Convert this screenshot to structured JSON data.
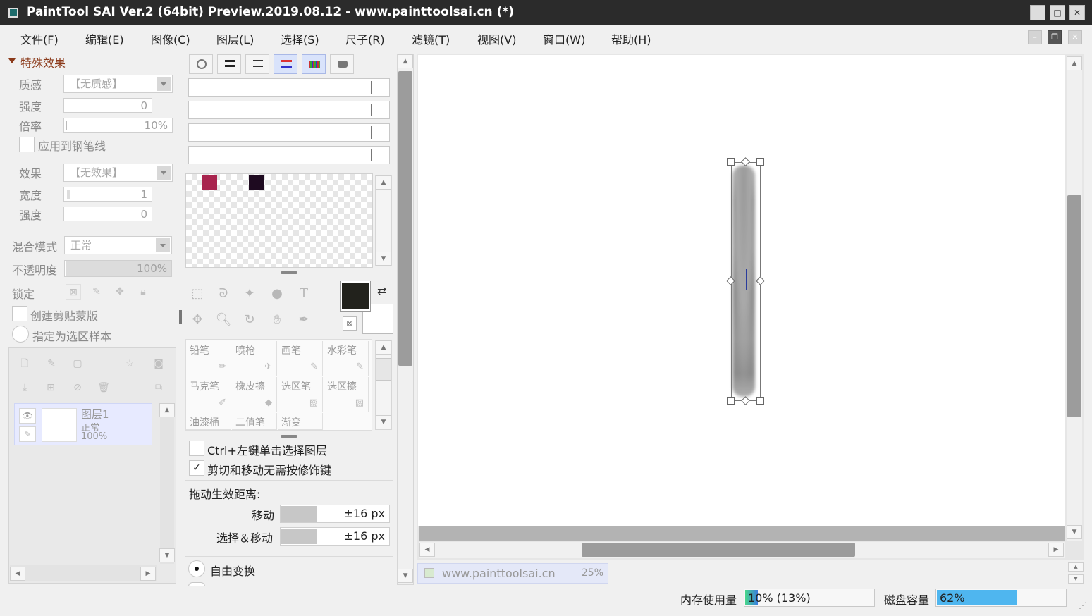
{
  "window": {
    "title": "PaintTool SAI Ver.2 (64bit) Preview.2019.08.12 - www.painttoolsai.cn (*)"
  },
  "menu": [
    "文件(F)",
    "编辑(E)",
    "图像(C)",
    "图层(L)",
    "选择(S)",
    "尺子(R)",
    "滤镜(T)",
    "视图(V)",
    "窗口(W)",
    "帮助(H)"
  ],
  "effects": {
    "header": "特殊效果",
    "texture_label": "质感",
    "texture_value": "【无质感】",
    "strength_label": "强度",
    "strength_value": "0",
    "scale_label": "倍率",
    "scale_value": "10%",
    "apply_pen_label": "应用到钢笔线",
    "effect_label": "效果",
    "effect_value": "【无效果】",
    "width_label": "宽度",
    "width_value": "1",
    "strength2_label": "强度",
    "strength2_value": "0"
  },
  "layer_props": {
    "blend_label": "混合模式",
    "blend_value": "正常",
    "opacity_label": "不透明度",
    "opacity_value": "100%",
    "opacity_level": 1.0,
    "lock_label": "锁定",
    "clip_label": "创建剪贴蒙版",
    "selection_source_label": "指定为选区样本"
  },
  "layers": [
    {
      "name": "图层1",
      "mode": "正常",
      "opacity": "100%"
    }
  ],
  "swatches": {
    "colors": [
      "#a8244e",
      "#1e0a20"
    ]
  },
  "colors": {
    "primary": "#22221c",
    "secondary": "#ffffff",
    "accent_border": "#e5a47a"
  },
  "brushes": [
    {
      "name": "铅笔",
      "icon": "pencil-icon"
    },
    {
      "name": "喷枪",
      "icon": "airbrush-icon"
    },
    {
      "name": "画笔",
      "icon": "brush-icon"
    },
    {
      "name": "水彩笔",
      "icon": "watercolor-icon"
    },
    {
      "name": "马克笔",
      "icon": "marker-icon"
    },
    {
      "name": "橡皮擦",
      "icon": "eraser-icon"
    },
    {
      "name": "选区笔",
      "icon": "select-pen-icon"
    },
    {
      "name": "选区擦",
      "icon": "select-eraser-icon"
    },
    {
      "name": "油漆桶",
      "icon": "bucket-icon"
    },
    {
      "name": "二值笔",
      "icon": "binary-pen-icon"
    },
    {
      "name": "渐变",
      "icon": "gradient-icon"
    }
  ],
  "options": {
    "ctrl_click_label": "Ctrl+左键单击选择图层",
    "ctrl_click_checked": false,
    "cut_move_label": "剪切和移动无需按修饰键",
    "cut_move_checked": true,
    "drag_distance_label": "拖动生效距离:",
    "move_label": "移动",
    "move_value": "±16 px",
    "select_move_label": "选择＆移动",
    "select_move_value": "±16 px",
    "free_transform_label": "自由变换",
    "free_transform_selected": true
  },
  "tab": {
    "name": "www.painttoolsai.cn",
    "zoom": "25%"
  },
  "status": {
    "memory_label": "内存使用量",
    "memory_value": "10% (13%)",
    "memory_level": 0.1,
    "disk_label": "磁盘容量",
    "disk_value": "62%",
    "disk_level": 0.62
  }
}
